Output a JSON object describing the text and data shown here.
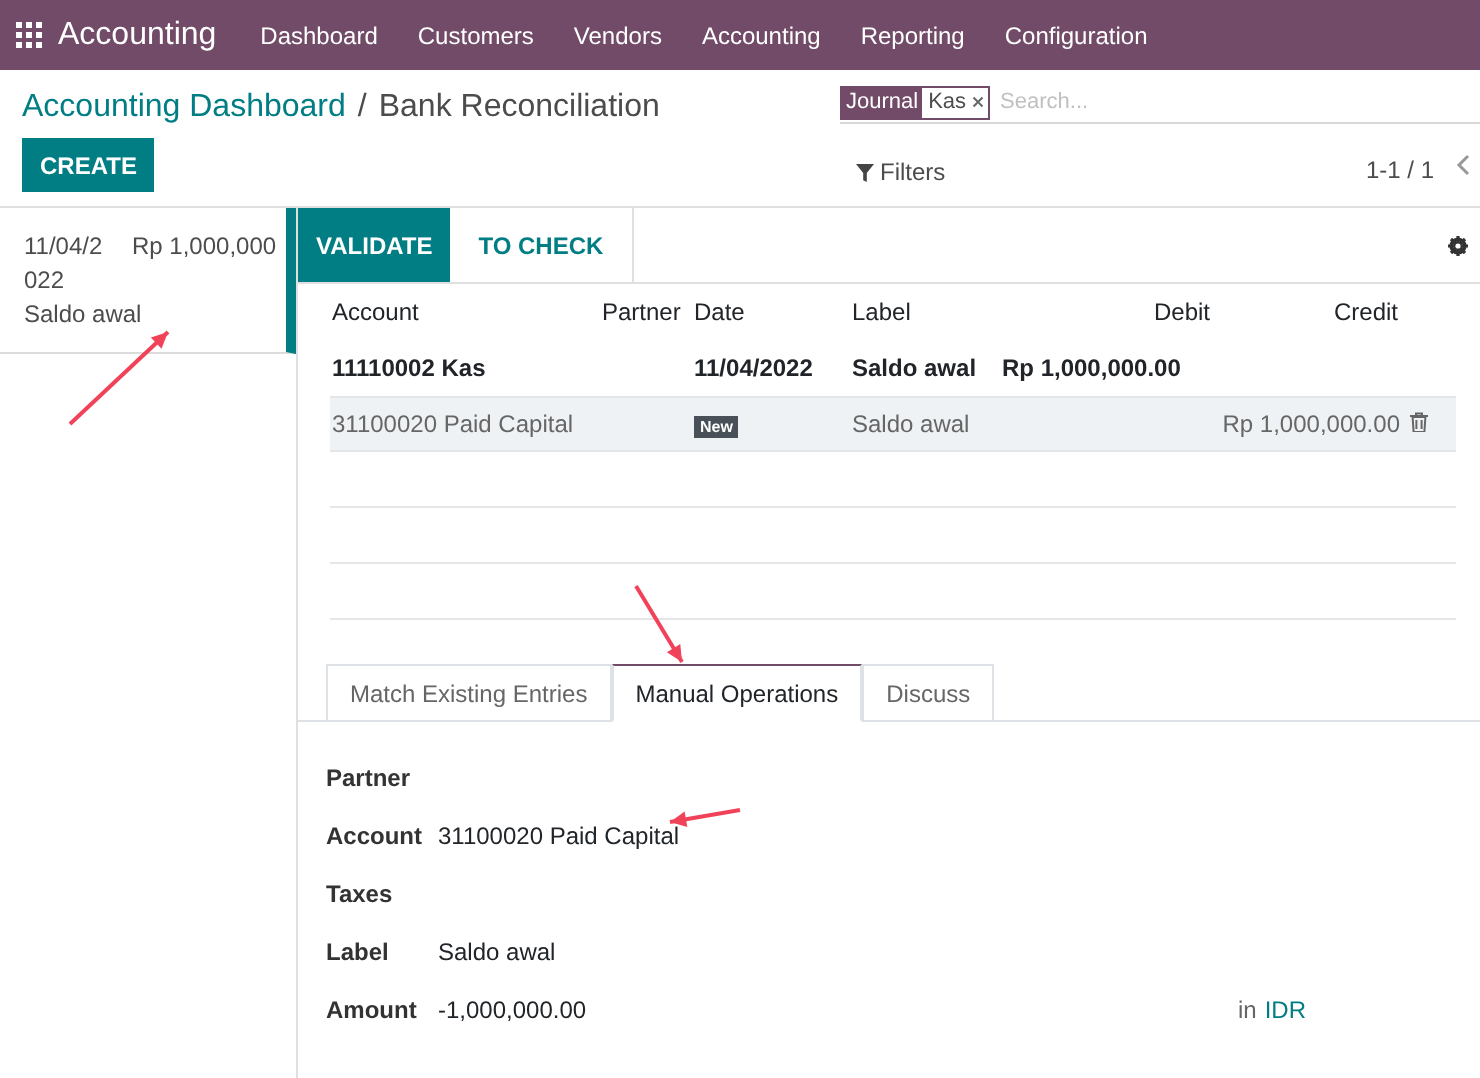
{
  "app": {
    "name": "Accounting"
  },
  "menu": [
    "Dashboard",
    "Customers",
    "Vendors",
    "Accounting",
    "Reporting",
    "Configuration"
  ],
  "breadcrumb": {
    "parent": "Accounting Dashboard",
    "separator": "/",
    "current": "Bank Reconciliation"
  },
  "search": {
    "facet_label": "Journal",
    "facet_value": "Kas",
    "placeholder": "Search..."
  },
  "create_button": "CREATE",
  "filters": "Filters",
  "pager": "1-1 / 1",
  "statement_lines": [
    {
      "date": "11/04/2022",
      "amount": "Rp 1,000,000",
      "label": "Saldo awal",
      "selected": true
    }
  ],
  "actions": [
    {
      "label": "VALIDATE",
      "selected": true
    },
    {
      "label": "TO CHECK",
      "selected": false
    }
  ],
  "table": {
    "columns": [
      "Account",
      "Partner",
      "Date",
      "Label",
      "Debit",
      "Credit"
    ],
    "rows": [
      {
        "kind": "statement",
        "account": "11110002 Kas",
        "date": "11/04/2022",
        "label": "Saldo awal",
        "debit": "Rp 1,000,000.00",
        "credit": ""
      },
      {
        "kind": "new",
        "account": "31100020 Paid Capital",
        "badge": "New",
        "label": "Saldo awal",
        "debit": "",
        "credit": "Rp 1,000,000.00"
      }
    ]
  },
  "tabs": [
    {
      "label": "Match Existing Entries",
      "selected": false
    },
    {
      "label": "Manual Operations",
      "selected": true
    },
    {
      "label": "Discuss",
      "selected": false
    }
  ],
  "form": [
    {
      "label": "Partner"
    },
    {
      "label": "Account",
      "value": "31100020 Paid Capital"
    },
    {
      "label": "Taxes"
    },
    {
      "label": "Label",
      "value": "Saldo awal"
    },
    {
      "label": "Amount",
      "value": "-1,000,000.00",
      "suffix": "in",
      "currency": "IDR"
    }
  ]
}
